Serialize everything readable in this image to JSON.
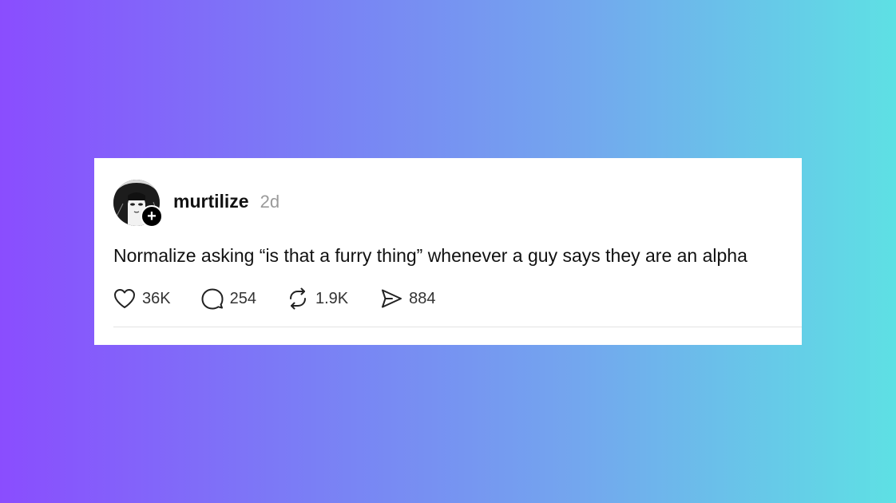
{
  "post": {
    "username": "murtilize",
    "time": "2d",
    "text": "Normalize asking “is that a furry thing” whenever a guy says they are an alpha",
    "follow_symbol": "+",
    "actions": {
      "likes": "36K",
      "replies": "254",
      "reposts": "1.9K",
      "shares": "884"
    },
    "icons": {
      "like": "heart-icon",
      "reply": "speech-bubble-icon",
      "repost": "repost-arrows-icon",
      "share": "paper-plane-icon"
    }
  },
  "colors": {
    "gradient_start": "#8a4dfe",
    "gradient_end": "#5ee0e4",
    "card_background": "#ffffff",
    "text_primary": "#111111",
    "text_secondary": "#9a9a9a"
  }
}
